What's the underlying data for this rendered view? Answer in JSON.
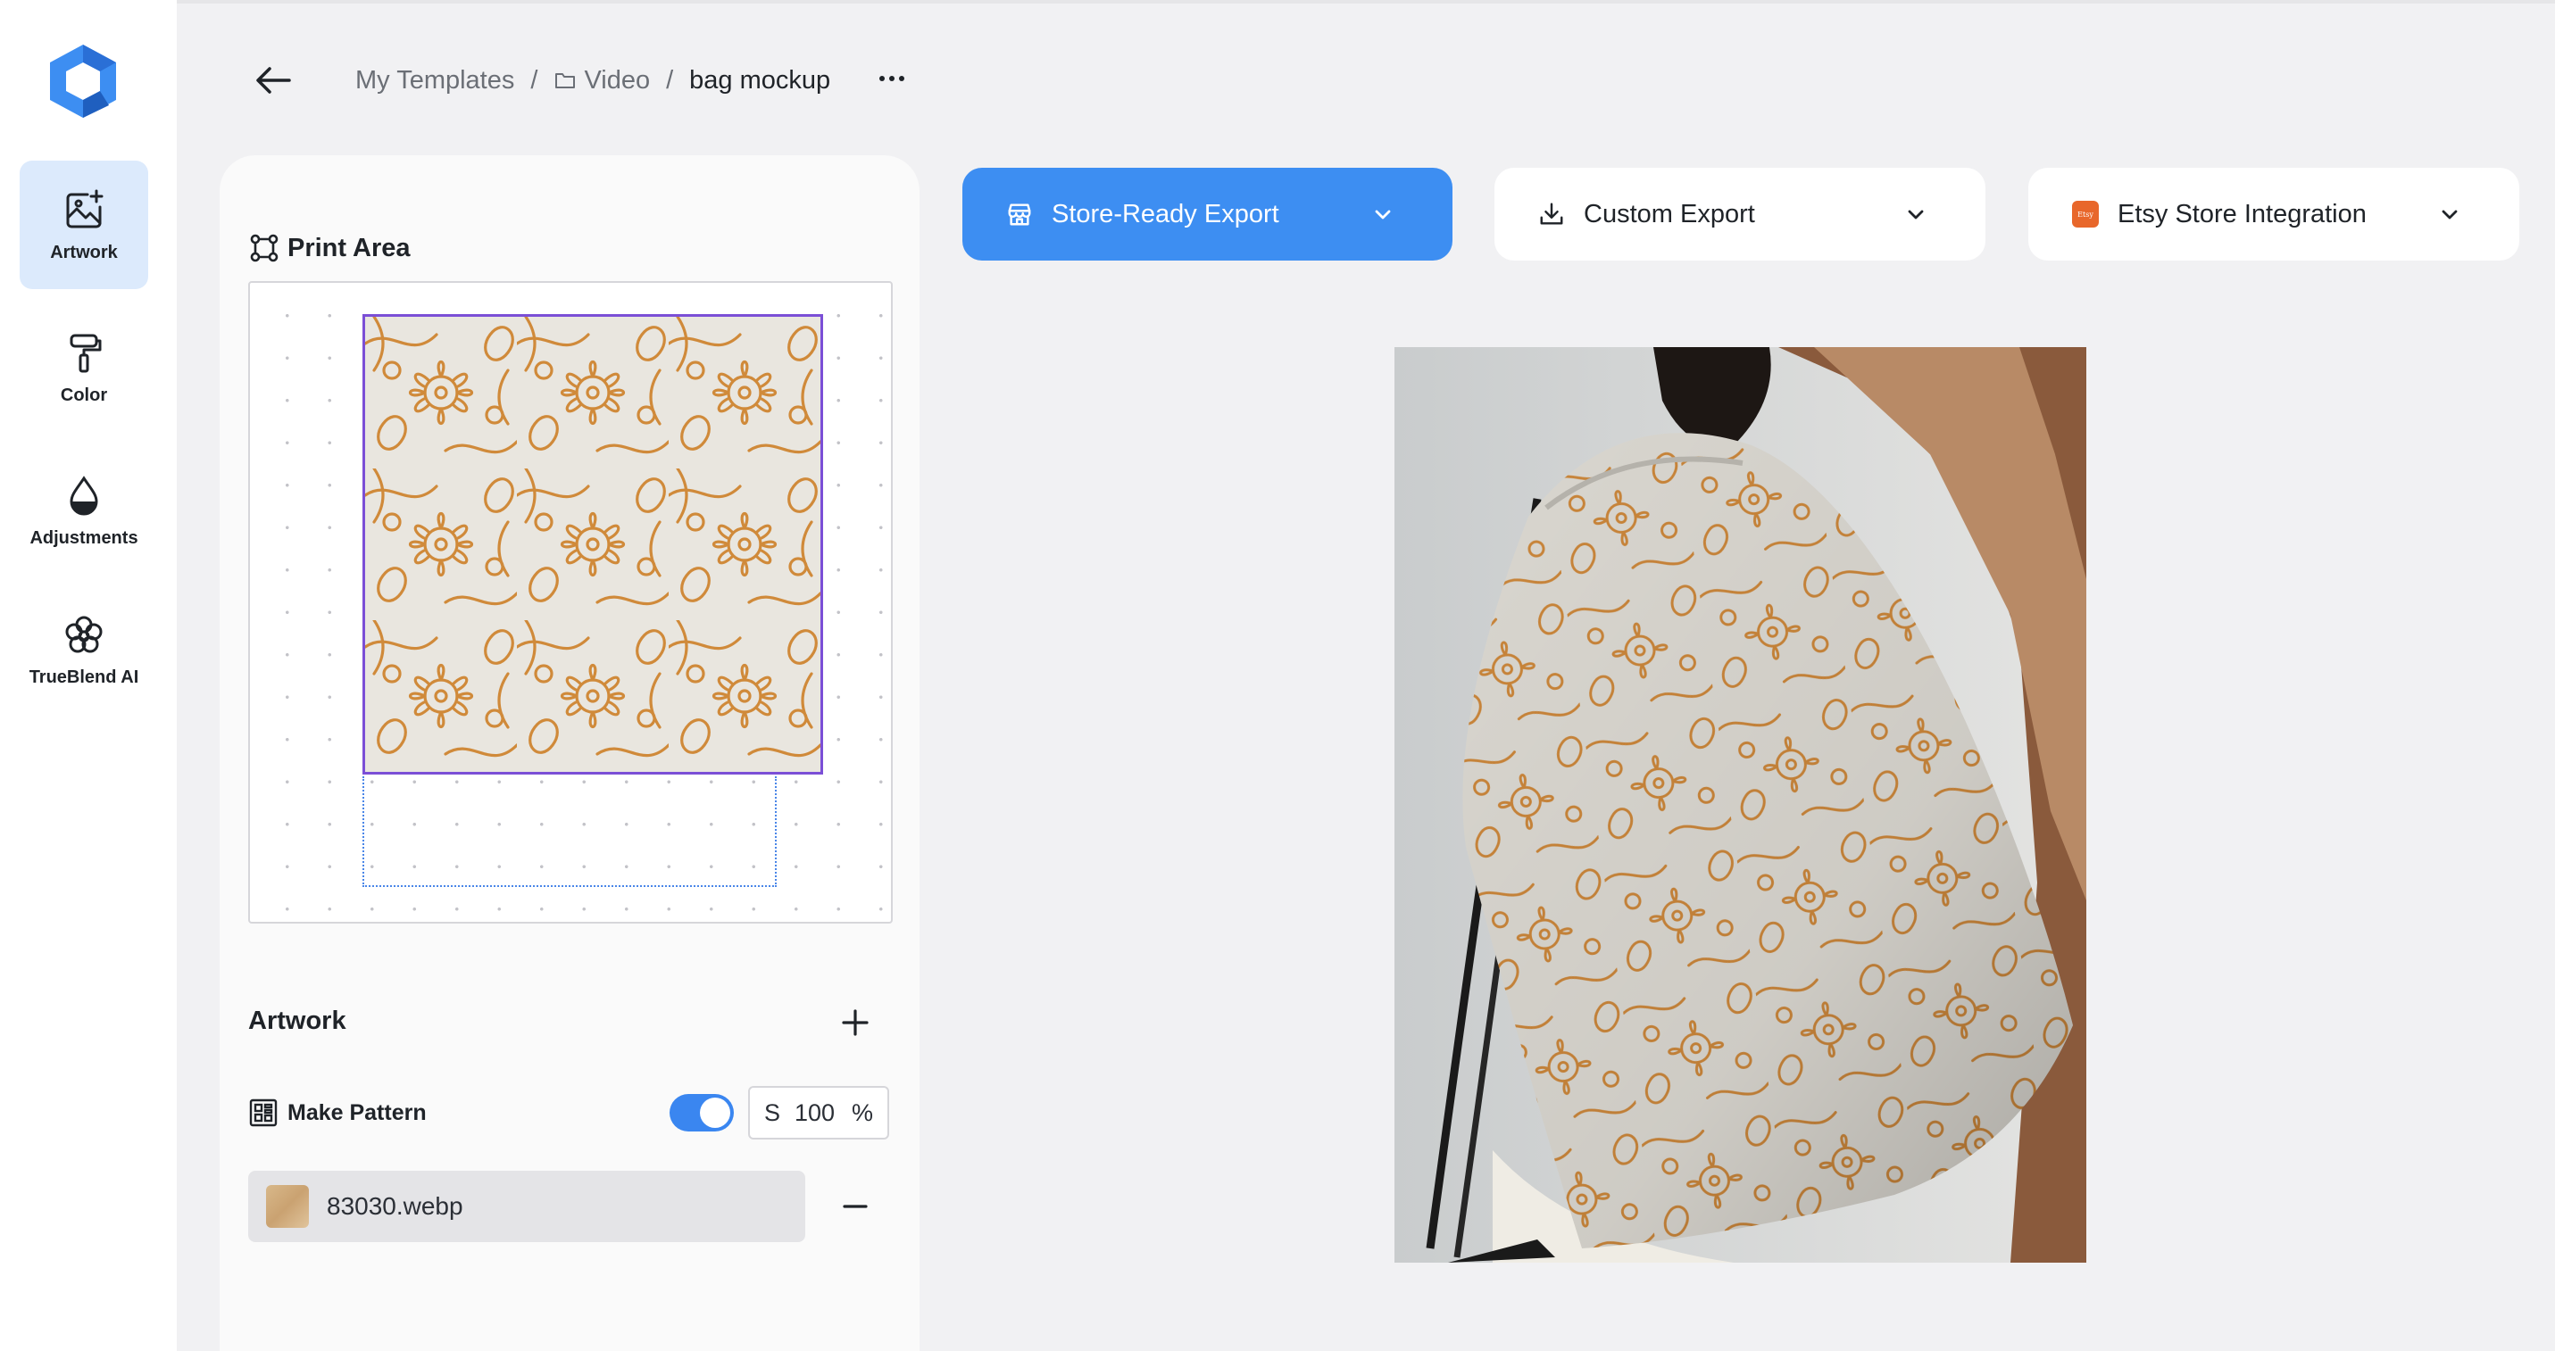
{
  "breadcrumb": {
    "root": "My Templates",
    "separator": "/",
    "folder": "Video",
    "current": "bag mockup"
  },
  "sidebar": {
    "items": [
      {
        "label": "Artwork",
        "icon": "image-add-icon",
        "active": true
      },
      {
        "label": "Color",
        "icon": "paint-roller-icon"
      },
      {
        "label": "Adjustments",
        "icon": "drop-icon"
      },
      {
        "label": "TrueBlend AI",
        "icon": "flower-ai-icon"
      }
    ]
  },
  "print_area": {
    "title": "Print Area"
  },
  "artwork": {
    "title": "Artwork",
    "make_pattern": {
      "label": "Make Pattern",
      "enabled": true,
      "scale_prefix": "S",
      "scale_value": "100",
      "scale_unit": "%"
    },
    "files": [
      {
        "name": "83030.webp"
      }
    ]
  },
  "exports": {
    "store_ready": "Store-Ready Export",
    "custom": "Custom Export",
    "etsy": "Etsy Store Integration",
    "etsy_badge": "Etsy"
  },
  "colors": {
    "accent": "#3d8ef2",
    "selection": "#7b4fd6",
    "pattern": "#d08a3a",
    "sidebar_active": "#dceafc"
  }
}
